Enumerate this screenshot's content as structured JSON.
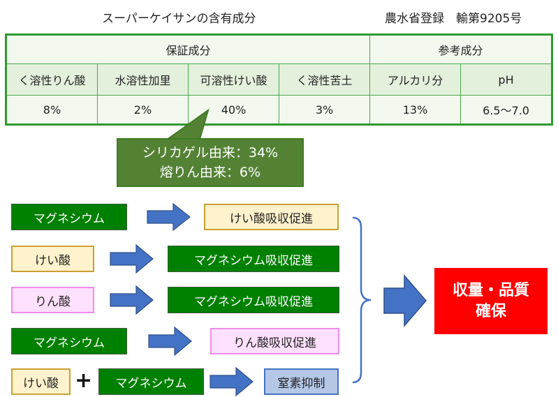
{
  "header": {
    "title": "スーパーケイサンの含有成分",
    "registration": "農水省登録　輸第9205号"
  },
  "table": {
    "groups": [
      {
        "label": "保証成分"
      },
      {
        "label": "参考成分"
      }
    ],
    "columns": [
      "く溶性りん酸",
      "水溶性加里",
      "可溶性けい酸",
      "く溶性苦土",
      "アルカリ分",
      "pH"
    ],
    "values": [
      "8%",
      "2%",
      "40%",
      "3%",
      "13%",
      "6.5～7.0"
    ]
  },
  "callout": {
    "line1": "シリカゲル由来：34%",
    "line2": "熔りん由来：6%"
  },
  "flows": [
    {
      "input": "マグネシウム",
      "output": "けい酸吸収促進"
    },
    {
      "input": "けい酸",
      "output": "マグネシウム吸収促進"
    },
    {
      "input": "りん酸",
      "output": "マグネシウム吸収促進"
    },
    {
      "input": "マグネシウム",
      "output": "りん酸吸収促進"
    },
    {
      "input": "けい酸",
      "plus": "+",
      "input2": "マグネシウム",
      "output": "窒素抑制"
    }
  ],
  "result": {
    "line1": "収量・品質",
    "line2": "確保"
  },
  "colors": {
    "green": "#008000",
    "table_border": "#2e9a2e",
    "callout": "#548235",
    "arrow": "#4472c4",
    "result": "#ff0000"
  }
}
